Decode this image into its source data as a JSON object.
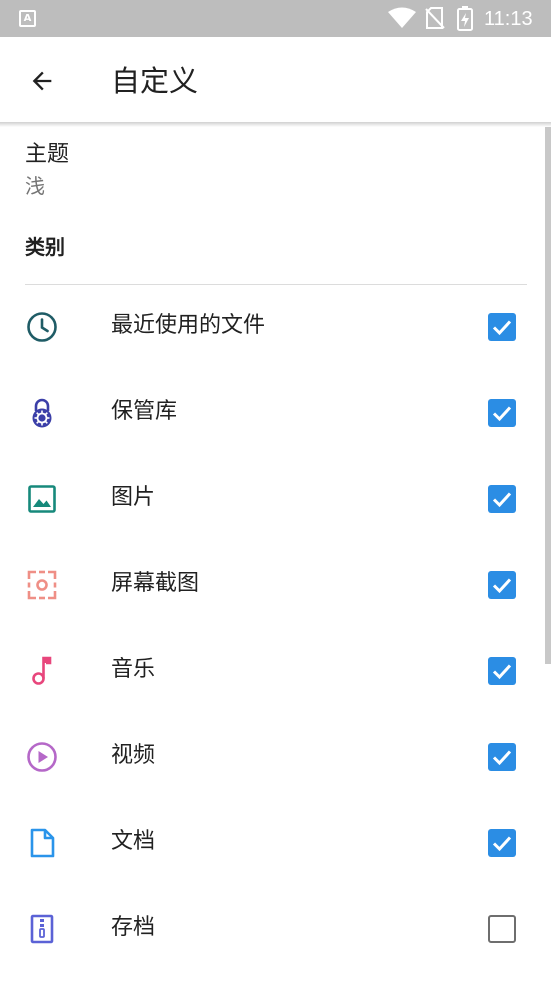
{
  "status_bar": {
    "notification_icon": "A",
    "time": "11:13",
    "icons": [
      "wifi-icon",
      "no-sim-icon",
      "battery-charging-icon"
    ]
  },
  "app_bar": {
    "back_icon": "arrow-left-icon",
    "title": "自定义"
  },
  "theme": {
    "title": "主题",
    "value": "浅"
  },
  "categories": {
    "header": "类别",
    "items": [
      {
        "label": "最近使用的文件",
        "icon": "clock-icon",
        "color": "#1f5c66",
        "checked": true
      },
      {
        "label": "保管库",
        "icon": "safe-lock-icon",
        "color": "#3b3fa8",
        "checked": true
      },
      {
        "label": "图片",
        "icon": "image-icon",
        "color": "#16897b",
        "checked": true
      },
      {
        "label": "屏幕截图",
        "icon": "screenshot-icon",
        "color": "#ef8f86",
        "checked": true
      },
      {
        "label": "音乐",
        "icon": "music-note-icon",
        "color": "#e8467c",
        "checked": true
      },
      {
        "label": "视频",
        "icon": "play-circle-icon",
        "color": "#b568c8",
        "checked": true
      },
      {
        "label": "文档",
        "icon": "document-icon",
        "color": "#2a94ea",
        "checked": true
      },
      {
        "label": "存档",
        "icon": "archive-zip-icon",
        "color": "#5b62d6",
        "checked": false
      }
    ]
  },
  "colors": {
    "checkbox_checked": "#2b8de4",
    "status_bar": "#bdbdbd",
    "secondary_text": "#757575"
  }
}
